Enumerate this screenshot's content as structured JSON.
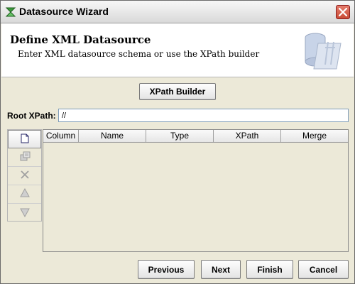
{
  "window": {
    "title": "Datasource Wizard"
  },
  "header": {
    "title": "Define XML Datasource",
    "subtitle": "Enter XML datasource schema or use the XPath builder"
  },
  "xpath_builder_label": "XPath Builder",
  "root_xpath": {
    "label": "Root XPath:",
    "value": "//"
  },
  "toolbar": [
    "new-icon",
    "copy-icon",
    "delete-icon",
    "move-up-icon",
    "move-down-icon"
  ],
  "table": {
    "columns": [
      "Column",
      "Name",
      "Type",
      "XPath",
      "Merge"
    ],
    "rows": []
  },
  "footer": {
    "previous": "Previous",
    "next": "Next",
    "finish": "Finish",
    "cancel": "Cancel"
  },
  "colors": {
    "accent_close": "#c94b35",
    "dialog_bg": "#ece9d8"
  }
}
